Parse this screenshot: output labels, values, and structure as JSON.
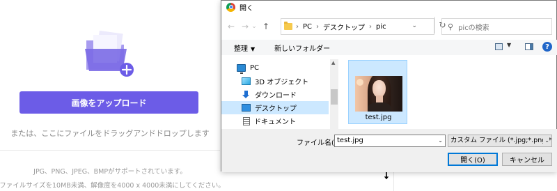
{
  "web": {
    "upload_button": "画像をアップロード",
    "drop_hint": "または、ここにファイルをドラッグアンドドロップします",
    "formats": "JPG、PNG、JPEG、BMPがサポートされています。",
    "limits": "ファイルサイズを10MB未満、解像度を4000 x 4000未満にしてください。",
    "accent_color": "#6c5ce7"
  },
  "dialog": {
    "title": "開く",
    "nav": {
      "back": "←",
      "forward": "→",
      "recent": "⌄",
      "up": "↑"
    },
    "breadcrumb": [
      "PC",
      "デスクトップ",
      "pic"
    ],
    "search_placeholder": "picの検索",
    "commands": {
      "organize": "整理",
      "new_folder": "新しいフォルダー",
      "help": "?"
    },
    "tree": [
      {
        "label": "PC",
        "icon": "pc-icon"
      },
      {
        "label": "3D オブジェクト",
        "icon": "3d-objects-icon"
      },
      {
        "label": "ダウンロード",
        "icon": "download-icon"
      },
      {
        "label": "デスクトップ",
        "icon": "desktop-icon",
        "selected": true
      },
      {
        "label": "ドキュメント",
        "icon": "document-icon"
      }
    ],
    "files": [
      {
        "name": "test.jpg",
        "selected": true
      }
    ],
    "filename_label": "ファイル名(N):",
    "filename_value": "test.jpg",
    "filter_value": "カスタム ファイル (*.jpg;*.png;*.jpe",
    "open_button": "開く(O)",
    "cancel_button": "キャンセル"
  }
}
